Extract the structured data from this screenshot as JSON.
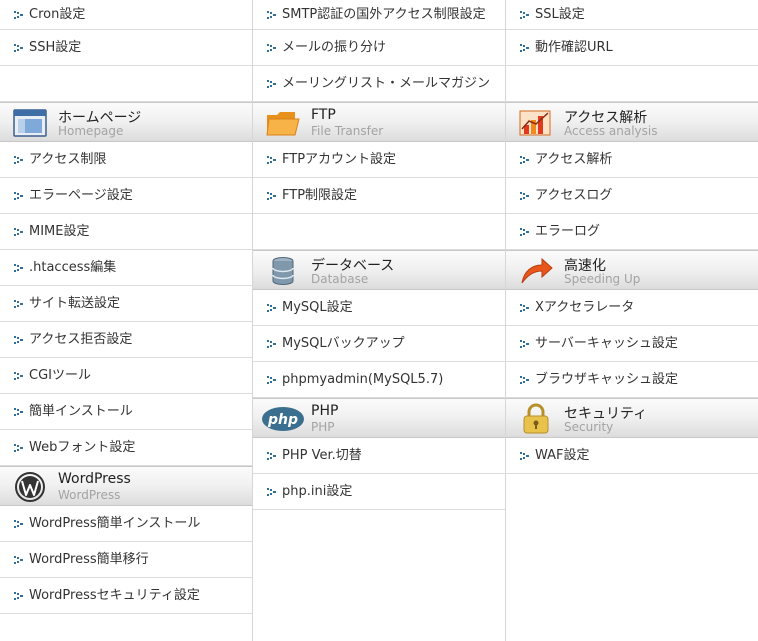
{
  "left": {
    "top_items": [
      {
        "label": "Cron設定"
      },
      {
        "label": "SSH設定"
      }
    ],
    "homepage": {
      "title": "ホームページ",
      "subtitle": "Homepage",
      "icon": "browser-window-icon",
      "items": [
        {
          "label": "アクセス制限"
        },
        {
          "label": "エラーページ設定"
        },
        {
          "label": "MIME設定"
        },
        {
          "label": ".htaccess編集"
        },
        {
          "label": "サイト転送設定"
        },
        {
          "label": "アクセス拒否設定"
        },
        {
          "label": "CGIツール"
        },
        {
          "label": "簡単インストール"
        },
        {
          "label": "Webフォント設定"
        }
      ]
    },
    "wordpress": {
      "title": "WordPress",
      "subtitle": "WordPress",
      "icon": "wordpress-logo-icon",
      "items": [
        {
          "label": "WordPress簡単インストール"
        },
        {
          "label": "WordPress簡単移行"
        },
        {
          "label": "WordPressセキュリティ設定"
        }
      ]
    }
  },
  "middle": {
    "top_items": [
      {
        "label": "SMTP認証の国外アクセス制限設定"
      },
      {
        "label": "メールの振り分け"
      },
      {
        "label": "メーリングリスト・メールマガジン"
      }
    ],
    "ftp": {
      "title": "FTP",
      "subtitle": "File Transfer",
      "icon": "folder-icon",
      "items": [
        {
          "label": "FTPアカウント設定"
        },
        {
          "label": "FTP制限設定"
        }
      ]
    },
    "database": {
      "title": "データベース",
      "subtitle": "Database",
      "icon": "database-icon",
      "items": [
        {
          "label": "MySQL設定"
        },
        {
          "label": "MySQLバックアップ"
        },
        {
          "label": "phpmyadmin(MySQL5.7)"
        }
      ]
    },
    "php": {
      "title": "PHP",
      "subtitle": "PHP",
      "icon": "php-logo-icon",
      "logo_text": "php",
      "items": [
        {
          "label": "PHP Ver.切替"
        },
        {
          "label": "php.ini設定"
        }
      ]
    }
  },
  "right": {
    "top_items": [
      {
        "label": "SSL設定"
      },
      {
        "label": "動作確認URL"
      }
    ],
    "access": {
      "title": "アクセス解析",
      "subtitle": "Access analysis",
      "icon": "bar-chart-icon",
      "items": [
        {
          "label": "アクセス解析"
        },
        {
          "label": "アクセスログ"
        },
        {
          "label": "エラーログ"
        }
      ]
    },
    "speed": {
      "title": "高速化",
      "subtitle": "Speeding Up",
      "icon": "speed-arrow-icon",
      "items": [
        {
          "label": "Xアクセラレータ"
        },
        {
          "label": "サーバーキャッシュ設定"
        },
        {
          "label": "ブラウザキャッシュ設定"
        }
      ]
    },
    "security": {
      "title": "セキュリティ",
      "subtitle": "Security",
      "icon": "padlock-icon",
      "items": [
        {
          "label": "WAF設定"
        }
      ]
    }
  },
  "colors": {
    "arrow": "#2f6f9a",
    "border": "#dcdcdc",
    "subtitle": "#a3a3a3"
  }
}
